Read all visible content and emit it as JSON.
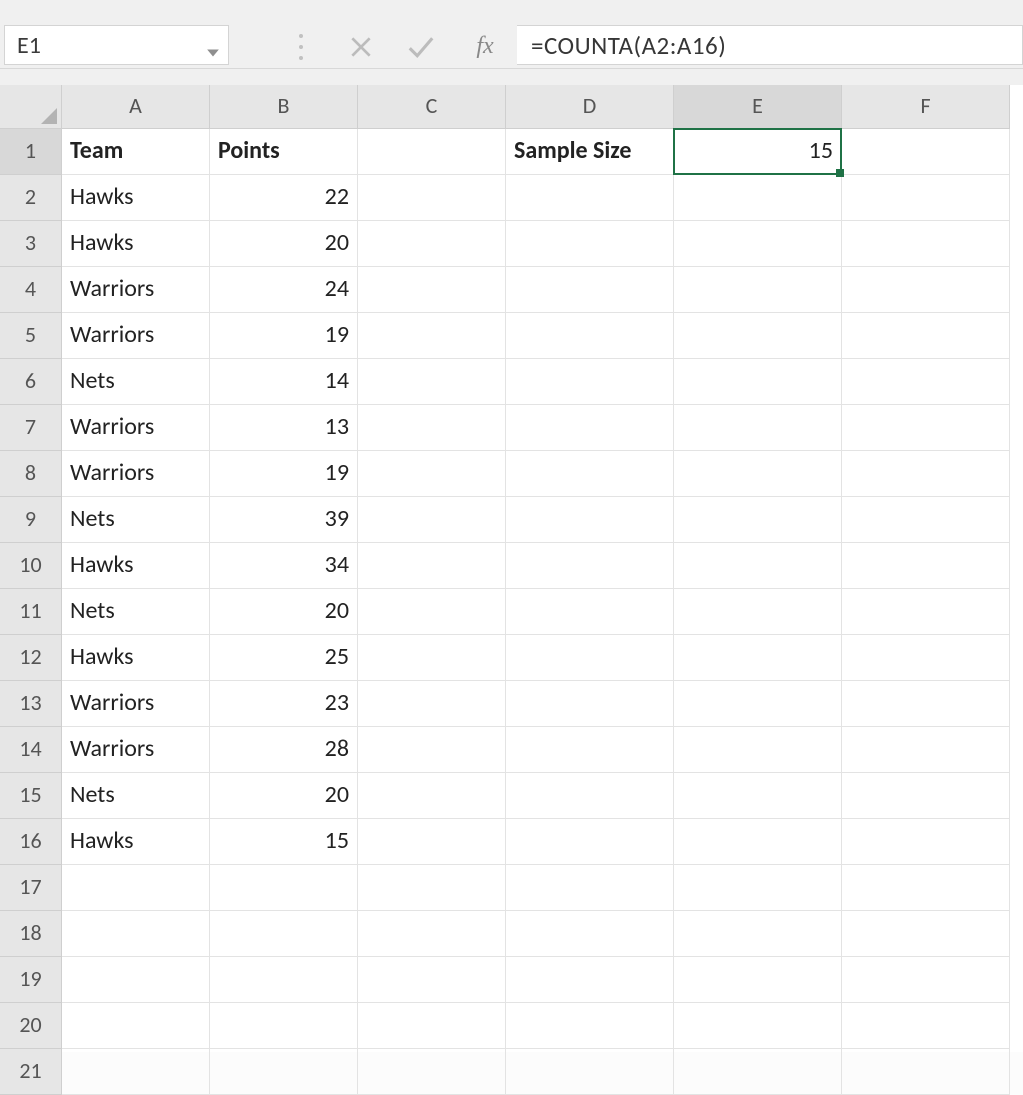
{
  "formula_bar": {
    "name_box": "E1",
    "formula": "=COUNTA(A2:A16)"
  },
  "columns": [
    "A",
    "B",
    "C",
    "D",
    "E",
    "F"
  ],
  "row_numbers": [
    "1",
    "2",
    "3",
    "4",
    "5",
    "6",
    "7",
    "8",
    "9",
    "10",
    "11",
    "12",
    "13",
    "14",
    "15",
    "16",
    "17",
    "18",
    "19",
    "20",
    "21"
  ],
  "active": {
    "col_index": 4,
    "row_index": 0
  },
  "headers": {
    "A": "Team",
    "B": "Points",
    "D": "Sample Size"
  },
  "e1_value": "15",
  "table": [
    {
      "team": "Hawks",
      "points": "22"
    },
    {
      "team": "Hawks",
      "points": "20"
    },
    {
      "team": "Warriors",
      "points": "24"
    },
    {
      "team": "Warriors",
      "points": "19"
    },
    {
      "team": "Nets",
      "points": "14"
    },
    {
      "team": "Warriors",
      "points": "13"
    },
    {
      "team": "Warriors",
      "points": "19"
    },
    {
      "team": "Nets",
      "points": "39"
    },
    {
      "team": "Hawks",
      "points": "34"
    },
    {
      "team": "Nets",
      "points": "20"
    },
    {
      "team": "Hawks",
      "points": "25"
    },
    {
      "team": "Warriors",
      "points": "23"
    },
    {
      "team": "Warriors",
      "points": "28"
    },
    {
      "team": "Nets",
      "points": "20"
    },
    {
      "team": "Hawks",
      "points": "15"
    }
  ],
  "fx_label": "fx"
}
